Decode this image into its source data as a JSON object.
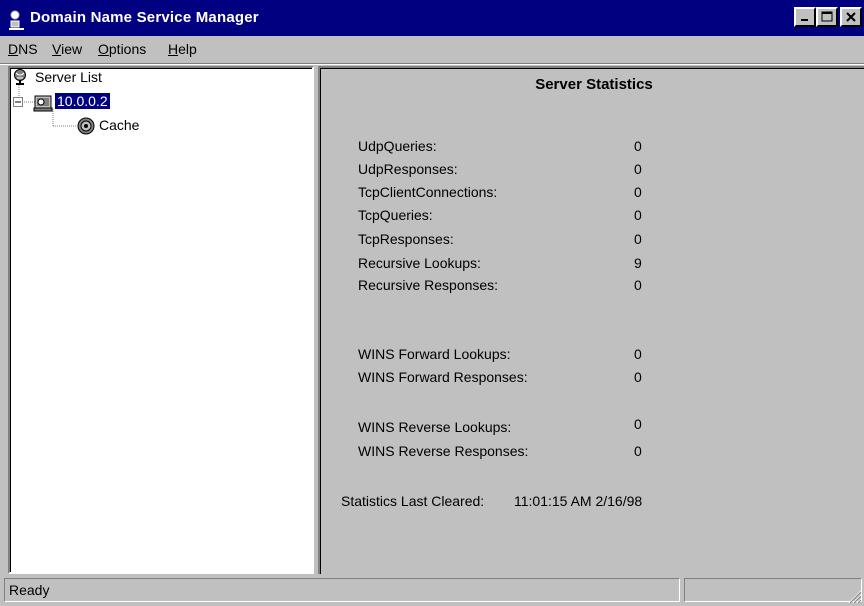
{
  "window": {
    "title": "Domain Name Service Manager"
  },
  "menu": {
    "items": [
      {
        "label": "DNS",
        "ul": "D",
        "rest": "NS"
      },
      {
        "label": "View",
        "ul": "V",
        "rest": "iew"
      },
      {
        "label": "Options",
        "ul": "O",
        "rest": "ptions"
      },
      {
        "label": "Help",
        "ul": "H",
        "rest": "elp"
      }
    ]
  },
  "tree": {
    "root": "Server List",
    "server": "10.0.0.2",
    "child": "Cache"
  },
  "stats": {
    "title": "Server Statistics",
    "rows": [
      {
        "label": "UdpQueries:",
        "value": "0"
      },
      {
        "label": "UdpResponses:",
        "value": "0"
      },
      {
        "label": "TcpClientConnections:",
        "value": "0"
      },
      {
        "label": "TcpQueries:",
        "value": "0"
      },
      {
        "label": "TcpResponses:",
        "value": "0"
      },
      {
        "label": "Recursive Lookups:",
        "value": "9"
      },
      {
        "label": "Recursive Responses:",
        "value": "0"
      }
    ],
    "wins_forward": [
      {
        "label": "WINS Forward Lookups:",
        "value": "0"
      },
      {
        "label": "WINS Forward Responses:",
        "value": "0"
      }
    ],
    "wins_reverse": [
      {
        "label": "WINS Reverse Lookups:",
        "value": "0"
      },
      {
        "label": "WINS Reverse Responses:",
        "value": "0"
      }
    ],
    "cleared_label": "Statistics Last Cleared:",
    "cleared_value": "11:01:15 AM 2/16/98"
  },
  "status": {
    "text": "Ready"
  },
  "icons": {
    "app": "dns-manager-icon",
    "server_list": "globe-icon",
    "server": "server-icon",
    "cache": "cache-icon"
  },
  "colors": {
    "titlebar": "#000080",
    "selection": "#000080",
    "face": "#c0c0c0"
  }
}
